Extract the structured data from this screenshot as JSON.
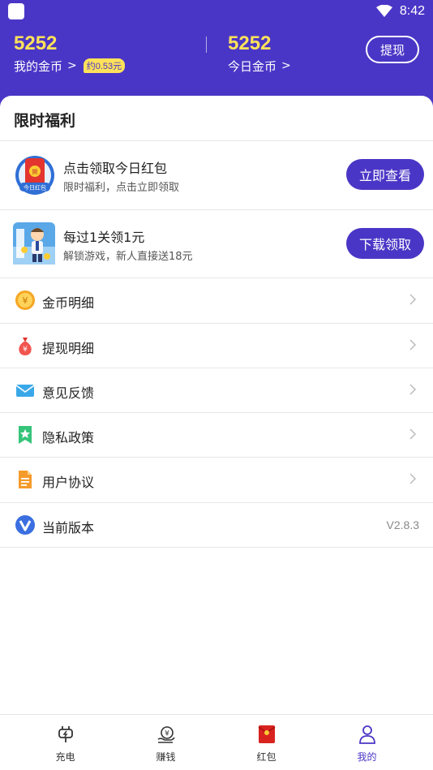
{
  "status_bar": {
    "time": "8:42"
  },
  "header": {
    "my_coins": {
      "value": "5252",
      "label": "我的金币",
      "approx": "约0.53元"
    },
    "today_coins": {
      "value": "5252",
      "label": "今日金币"
    },
    "withdraw_label": "提现"
  },
  "section": {
    "title": "限时福利"
  },
  "promos": [
    {
      "title": "点击领取今日红包",
      "subtitle": "限时福利，点击立即领取",
      "button": "立即查看",
      "icon": "red-envelope-icon",
      "icon_text": "今日红包"
    },
    {
      "title": "每过1关领1元",
      "subtitle": "解锁游戏，新人直接送18元",
      "button": "下载领取",
      "icon": "game-character-icon"
    }
  ],
  "menu": [
    {
      "label": "金币明细",
      "icon": "coin-icon"
    },
    {
      "label": "提现明细",
      "icon": "money-bag-icon"
    },
    {
      "label": "意见反馈",
      "icon": "mail-icon"
    },
    {
      "label": "隐私政策",
      "icon": "bookmark-star-icon"
    },
    {
      "label": "用户协议",
      "icon": "document-icon"
    },
    {
      "label": "当前版本",
      "icon": "version-v-icon",
      "value": "V2.8.3"
    }
  ],
  "bottom_nav": [
    {
      "label": "充电",
      "icon": "charge-icon",
      "active": false
    },
    {
      "label": "赚钱",
      "icon": "earn-money-icon",
      "active": false
    },
    {
      "label": "红包",
      "icon": "red-packet-icon",
      "active": false
    },
    {
      "label": "我的",
      "icon": "user-icon",
      "active": true
    }
  ],
  "colors": {
    "primary": "#4a36c6",
    "coin_yellow": "#ffe25a",
    "red": "#e3342f"
  }
}
